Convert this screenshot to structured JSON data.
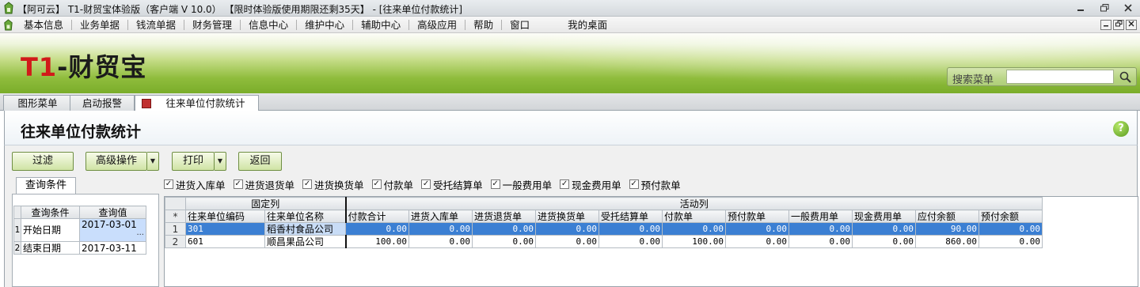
{
  "window": {
    "title": "【阿可云】 T1-财贸宝体验版（客户端 V 10.0） 【限时体验版使用期限还剩35天】 - [往来单位付款统计]",
    "controls": [
      "minimize",
      "restore",
      "close"
    ]
  },
  "menu": {
    "items": [
      "基本信息",
      "业务单据",
      "钱流单据",
      "财务管理",
      "信息中心",
      "维护中心",
      "辅助中心",
      "高级应用",
      "帮助",
      "窗口"
    ],
    "desktop": "我的桌面"
  },
  "banner": {
    "logo_prefix": "T1",
    "logo_rest": "-财贸宝",
    "search_label": "搜索菜单",
    "search_value": ""
  },
  "tabs": [
    {
      "label": "图形菜单",
      "active": false
    },
    {
      "label": "启动报警",
      "active": false
    },
    {
      "label": "往来单位付款统计",
      "active": true
    }
  ],
  "page": {
    "title": "往来单位付款统计",
    "help_glyph": "?"
  },
  "toolbar": {
    "filter": "过滤",
    "advanced": "高级操作",
    "print": "打印",
    "back": "返回"
  },
  "query": {
    "tab_label": "查询条件",
    "headers": [
      "查询条件",
      "查询值"
    ],
    "rows": [
      {
        "no": "1",
        "name": "开始日期",
        "value": "2017-03-01"
      },
      {
        "no": "2",
        "name": "结束日期",
        "value": "2017-03-11"
      }
    ]
  },
  "checkboxes": [
    "进货入库单",
    "进货退货单",
    "进货换货单",
    "付款单",
    "受托结算单",
    "一般费用单",
    "现金费用单",
    "预付款单"
  ],
  "grid": {
    "fixed_group": "固定列",
    "active_group": "活动列",
    "corner": "*",
    "columns": [
      "往来单位编码",
      "往来单位名称",
      "付款合计",
      "进货入库单",
      "进货退货单",
      "进货换货单",
      "受托结算单",
      "付款单",
      "预付款单",
      "一般费用单",
      "现金费用单",
      "应付余额",
      "预付余额"
    ],
    "rows": [
      {
        "no": "1",
        "cells": [
          "301",
          "稻香村食品公司",
          "0.00",
          "0.00",
          "0.00",
          "0.00",
          "0.00",
          "0.00",
          "0.00",
          "0.00",
          "0.00",
          "90.00",
          "0.00"
        ]
      },
      {
        "no": "2",
        "cells": [
          "601",
          "顺昌果品公司",
          "100.00",
          "0.00",
          "0.00",
          "0.00",
          "0.00",
          "100.00",
          "0.00",
          "0.00",
          "0.00",
          "860.00",
          "0.00"
        ]
      }
    ]
  }
}
